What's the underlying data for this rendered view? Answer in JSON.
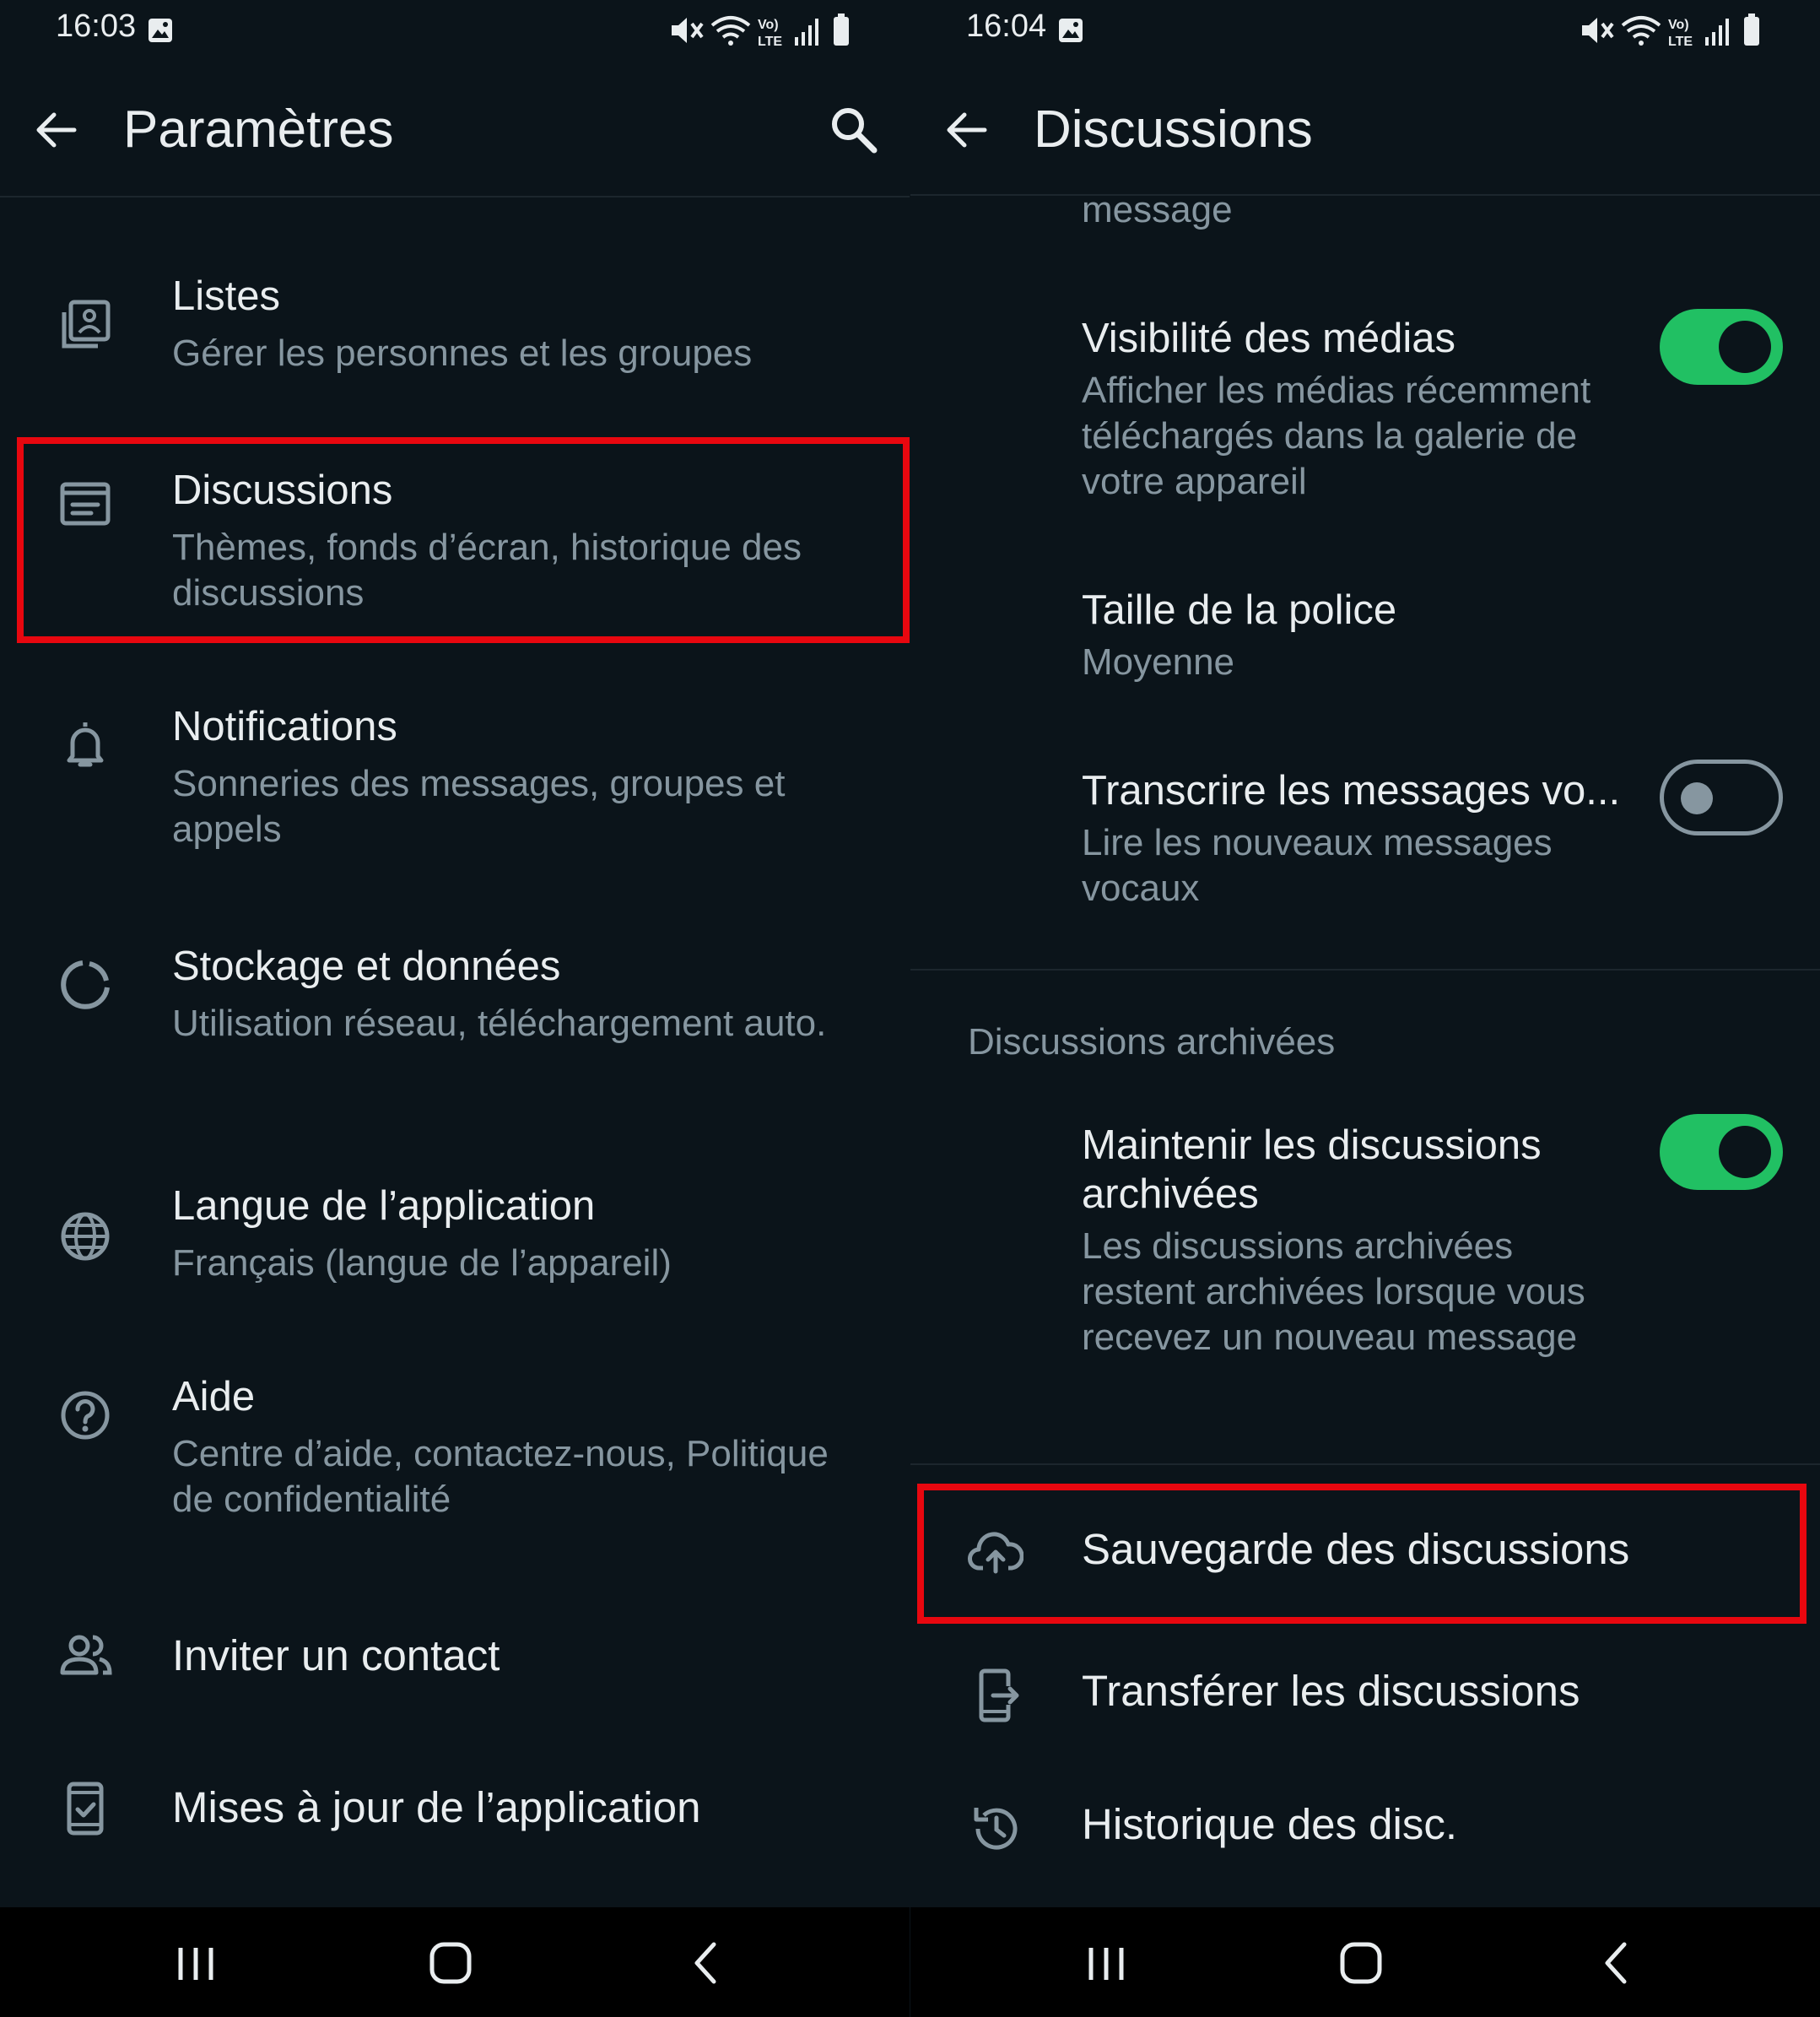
{
  "left": {
    "status": {
      "time": "16:03"
    },
    "appbar": {
      "title": "Paramètres"
    },
    "items": [
      {
        "title": "Listes",
        "subtitle": "Gérer les personnes et les groupes",
        "icon": "lists-icon"
      },
      {
        "title": "Discussions",
        "subtitle": "Thèmes, fonds d’écran, historique des discussions",
        "icon": "chat-icon",
        "highlighted": true
      },
      {
        "title": "Notifications",
        "subtitle": "Sonneries des messages, groupes et appels",
        "icon": "bell-icon"
      },
      {
        "title": "Stockage et données",
        "subtitle": "Utilisation réseau, téléchargement auto.",
        "icon": "storage-icon"
      },
      {
        "title": "Langue de l’application",
        "subtitle": "Français (langue de l’appareil)",
        "icon": "globe-icon"
      },
      {
        "title": "Aide",
        "subtitle": "Centre d’aide, contactez-nous, Politique de confidentialité",
        "icon": "help-icon"
      },
      {
        "title": "Inviter un contact",
        "icon": "invite-contact-icon"
      },
      {
        "title": "Mises à jour de l’application",
        "icon": "app-updates-icon"
      }
    ]
  },
  "right": {
    "status": {
      "time": "16:04"
    },
    "appbar": {
      "title": "Discussions"
    },
    "partial_text": "message",
    "settings": [
      {
        "title": "Visibilité des médias",
        "subtitle": "Afficher les médias récemment téléchargés dans la galerie de votre appareil",
        "toggle": true
      },
      {
        "title": "Taille de la police",
        "subtitle": "Moyenne"
      },
      {
        "title": "Transcrire les messages vo...",
        "subtitle": "Lire les nouveaux messages vocaux",
        "toggle": false
      }
    ],
    "section_archived": "Discussions archivées",
    "archived_setting": {
      "title": "Maintenir les discussions archivées",
      "subtitle": "Les discussions archivées restent archivées lorsque vous recevez un nouveau message",
      "toggle": true
    },
    "actions": [
      {
        "title": "Sauvegarde des discussions",
        "icon": "cloud-upload-icon",
        "highlighted": true
      },
      {
        "title": "Transférer les discussions",
        "icon": "phone-transfer-icon"
      },
      {
        "title": "Historique des disc.",
        "icon": "history-icon"
      }
    ]
  },
  "colors": {
    "background": "#0b141a",
    "accent": "#21c063",
    "highlight": "#e8070f",
    "secondary_text": "#8696a0"
  }
}
